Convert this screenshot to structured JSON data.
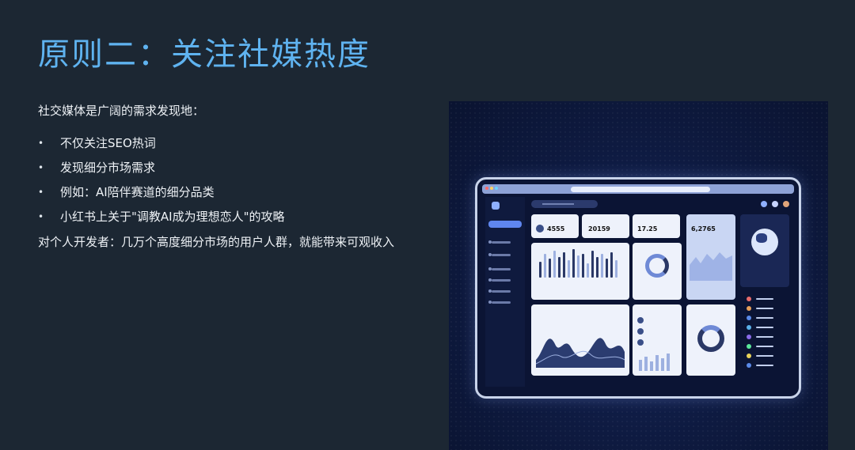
{
  "title": "原则二：关注社媒热度",
  "intro": "社交媒体是广阔的需求发现地：",
  "bullets": [
    "不仅关注SEO热词",
    "发现细分市场需求",
    "例如：AI陪伴赛道的细分品类",
    "小红书上关于\"调教AI成为理想恋人\"的攻略"
  ],
  "bullet_symbol": "•",
  "closing": "对个人开发者：几万个高度细分市场的用户人群，就能带来可观收入",
  "colors": {
    "background": "#1c2733",
    "title": "#5fb3f0",
    "text": "#eef2f6",
    "illustration_bg": "#0e1a40",
    "accent": "#5f86ef"
  },
  "illustration": {
    "stats": [
      {
        "value": "4555"
      },
      {
        "value": "20159"
      },
      {
        "value": "17.25"
      },
      {
        "value": "6,2765"
      }
    ]
  }
}
